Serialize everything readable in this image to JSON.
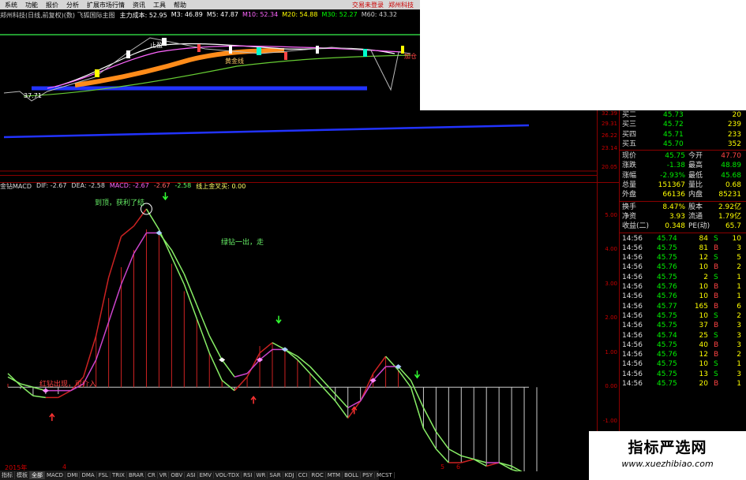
{
  "menu": {
    "items": [
      "系统",
      "功能",
      "报价",
      "分析",
      "扩展市场行情",
      "资讯",
      "工具",
      "帮助"
    ],
    "right_items": [
      "交易未登录",
      "郑州科技"
    ]
  },
  "top_chart": {
    "title": "郑州科技(日线,前复权)(数) 飞狐国际主图",
    "indicators": [
      {
        "label": "主力成本: 52.95",
        "color": "#ffffff"
      },
      {
        "label": "M3: 46.89",
        "color": "#ffffff"
      },
      {
        "label": "M5: 47.87",
        "color": "#ffffff"
      },
      {
        "label": "M10: 52.34",
        "color": "#ff66ff"
      },
      {
        "label": "M20: 54.88",
        "color": "#ffff00"
      },
      {
        "label": "M30: 52.27",
        "color": "#00ff00"
      },
      {
        "label": "M60: 43.32",
        "color": "#cccccc"
      }
    ],
    "annotations": [
      "止盈",
      "黄金线",
      "37.71",
      "加仓"
    ]
  },
  "price_axis": [
    "32.39",
    "29.31",
    "26.22",
    "23.14",
    "20.05"
  ],
  "macd": {
    "header": "金钻MACD",
    "dif": "DIF: -2.67",
    "dea": "DEA: -2.58",
    "macd_label": "MACD: -2.67",
    "v2": "-2.67",
    "v3": "-2.58",
    "signal": "线上金叉买: 0.00",
    "axis": [
      "5.00",
      "4.00",
      "3.00",
      "2.00",
      "1.00",
      "0.00",
      "-1.00",
      "-2.00"
    ],
    "annotations": {
      "top": "到顶，获利了结",
      "green": "绿钻一出，走",
      "red": "红钻出现，可介入"
    },
    "chart_data": {
      "type": "line",
      "x": [
        0,
        1,
        2,
        3,
        4,
        5,
        6,
        7,
        8,
        9,
        10,
        11,
        12,
        13,
        14,
        15,
        16,
        17,
        18,
        19,
        20,
        21,
        22,
        23,
        24,
        25,
        26,
        27,
        28,
        29,
        30,
        31,
        32,
        33,
        34,
        35,
        36,
        37,
        38,
        39,
        40,
        41,
        42
      ],
      "ylim": [
        -2.2,
        5.5
      ],
      "series": [
        {
          "name": "DIF",
          "values": [
            0.4,
            0.05,
            -0.25,
            -0.3,
            -0.3,
            -0.1,
            0.3,
            1.5,
            3.2,
            4.4,
            4.7,
            5.2,
            4.6,
            3.8,
            3.0,
            2.0,
            1.0,
            0.2,
            -0.1,
            0.3,
            1.0,
            1.3,
            1.1,
            0.8,
            0.4,
            0.0,
            -0.4,
            -0.9,
            -0.4,
            0.4,
            0.9,
            0.5,
            0.0,
            -1.2,
            -1.8,
            -2.2,
            -2.2,
            -2.1,
            -2.3,
            -2.2,
            -2.4,
            -2.5,
            -2.7
          ]
        },
        {
          "name": "DEA",
          "values": [
            0.3,
            0.1,
            0.0,
            -0.1,
            -0.1,
            -0.1,
            0.1,
            0.8,
            1.9,
            3.0,
            3.9,
            4.5,
            4.5,
            4.0,
            3.3,
            2.4,
            1.5,
            0.8,
            0.3,
            0.4,
            0.8,
            1.1,
            1.1,
            0.9,
            0.6,
            0.2,
            -0.2,
            -0.6,
            -0.4,
            0.2,
            0.6,
            0.6,
            0.2,
            -0.6,
            -1.3,
            -1.8,
            -2.0,
            -2.1,
            -2.2,
            -2.2,
            -2.3,
            -2.5,
            -2.6
          ]
        },
        {
          "name": "MACD",
          "values": [
            0.1,
            -0.05,
            -0.25,
            -0.2,
            -0.2,
            0.0,
            0.2,
            1.5,
            2.6,
            3.5,
            4.0,
            4.6,
            4.6,
            3.6,
            2.8,
            2.0,
            1.0,
            0.2,
            -0.1,
            0.3,
            1.2,
            1.3,
            1.1,
            0.8,
            0.4,
            0.0,
            -0.4,
            -0.9,
            -0.4,
            0.4,
            0.9,
            0.5,
            0.0,
            -1.2,
            -1.8,
            -2.2,
            -2.2,
            -2.1,
            -2.3,
            -2.2,
            -2.4,
            -2.5,
            -2.7
          ]
        }
      ]
    }
  },
  "quote": {
    "book": [
      {
        "label": "买二",
        "price": "45.73",
        "vol": "20"
      },
      {
        "label": "买三",
        "price": "45.72",
        "vol": "239"
      },
      {
        "label": "买四",
        "price": "45.71",
        "vol": "233"
      },
      {
        "label": "买五",
        "price": "45.70",
        "vol": "352"
      }
    ],
    "stats": [
      {
        "l1": "现价",
        "v1": "45.75",
        "l2": "今开",
        "v2": "47.70"
      },
      {
        "l1": "涨跌",
        "v1": "-1.38",
        "l2": "最高",
        "v2": "48.89"
      },
      {
        "l1": "涨幅",
        "v1": "-2.93%",
        "l2": "最低",
        "v2": "45.68"
      },
      {
        "l1": "总量",
        "v1": "151367",
        "l2": "量比",
        "v2": "0.68"
      },
      {
        "l1": "外盘",
        "v1": "66136",
        "l2": "内盘",
        "v2": "85231"
      },
      {
        "l1": "换手",
        "v1": "8.47%",
        "l2": "股本",
        "v2": "2.92亿"
      },
      {
        "l1": "净资",
        "v1": "3.93",
        "l2": "流通",
        "v2": "1.79亿"
      },
      {
        "l1": "收益(二)",
        "v1": "0.348",
        "l2": "PE(动)",
        "v2": "65.7"
      }
    ],
    "ticks": [
      {
        "t": "14:56",
        "p": "45.74",
        "v": "84",
        "s": "S",
        "n": "10"
      },
      {
        "t": "14:56",
        "p": "45.75",
        "v": "81",
        "s": "B",
        "n": "3"
      },
      {
        "t": "14:56",
        "p": "45.75",
        "v": "12",
        "s": "S",
        "n": "5"
      },
      {
        "t": "14:56",
        "p": "45.76",
        "v": "10",
        "s": "B",
        "n": "2"
      },
      {
        "t": "14:56",
        "p": "45.75",
        "v": "2",
        "s": "S",
        "n": "1"
      },
      {
        "t": "14:56",
        "p": "45.76",
        "v": "10",
        "s": "B",
        "n": "1"
      },
      {
        "t": "14:56",
        "p": "45.76",
        "v": "10",
        "s": "B",
        "n": "1"
      },
      {
        "t": "14:56",
        "p": "45.77",
        "v": "165",
        "s": "B",
        "n": "6"
      },
      {
        "t": "14:56",
        "p": "45.75",
        "v": "10",
        "s": "S",
        "n": "2"
      },
      {
        "t": "14:56",
        "p": "45.75",
        "v": "37",
        "s": "B",
        "n": "3"
      },
      {
        "t": "14:56",
        "p": "45.74",
        "v": "25",
        "s": "S",
        "n": "3"
      },
      {
        "t": "14:56",
        "p": "45.75",
        "v": "40",
        "s": "B",
        "n": "3"
      },
      {
        "t": "14:56",
        "p": "45.76",
        "v": "12",
        "s": "B",
        "n": "2"
      },
      {
        "t": "14:56",
        "p": "45.75",
        "v": "10",
        "s": "S",
        "n": "1"
      },
      {
        "t": "14:56",
        "p": "45.75",
        "v": "13",
        "s": "S",
        "n": "3"
      },
      {
        "t": "14:56",
        "p": "45.75",
        "v": "20",
        "s": "B",
        "n": "1"
      }
    ]
  },
  "time_axis": {
    "year": "2015年",
    "m1": "4",
    "m2": "5",
    "m3": "6"
  },
  "tabs": [
    "指标",
    "模板",
    "全部",
    "MACD",
    "DMI",
    "DMA",
    "FSL",
    "TRIX",
    "BRAR",
    "CR",
    "VR",
    "OBV",
    "ASI",
    "EMV",
    "VOL-TDX",
    "RSI",
    "WR",
    "SAR",
    "KDJ",
    "CCI",
    "ROC",
    "MTM",
    "BOLL",
    "PSY",
    "MCST"
  ],
  "watermark": {
    "line1": "指标严选网",
    "line2": "www.xuezhibiao.com"
  }
}
